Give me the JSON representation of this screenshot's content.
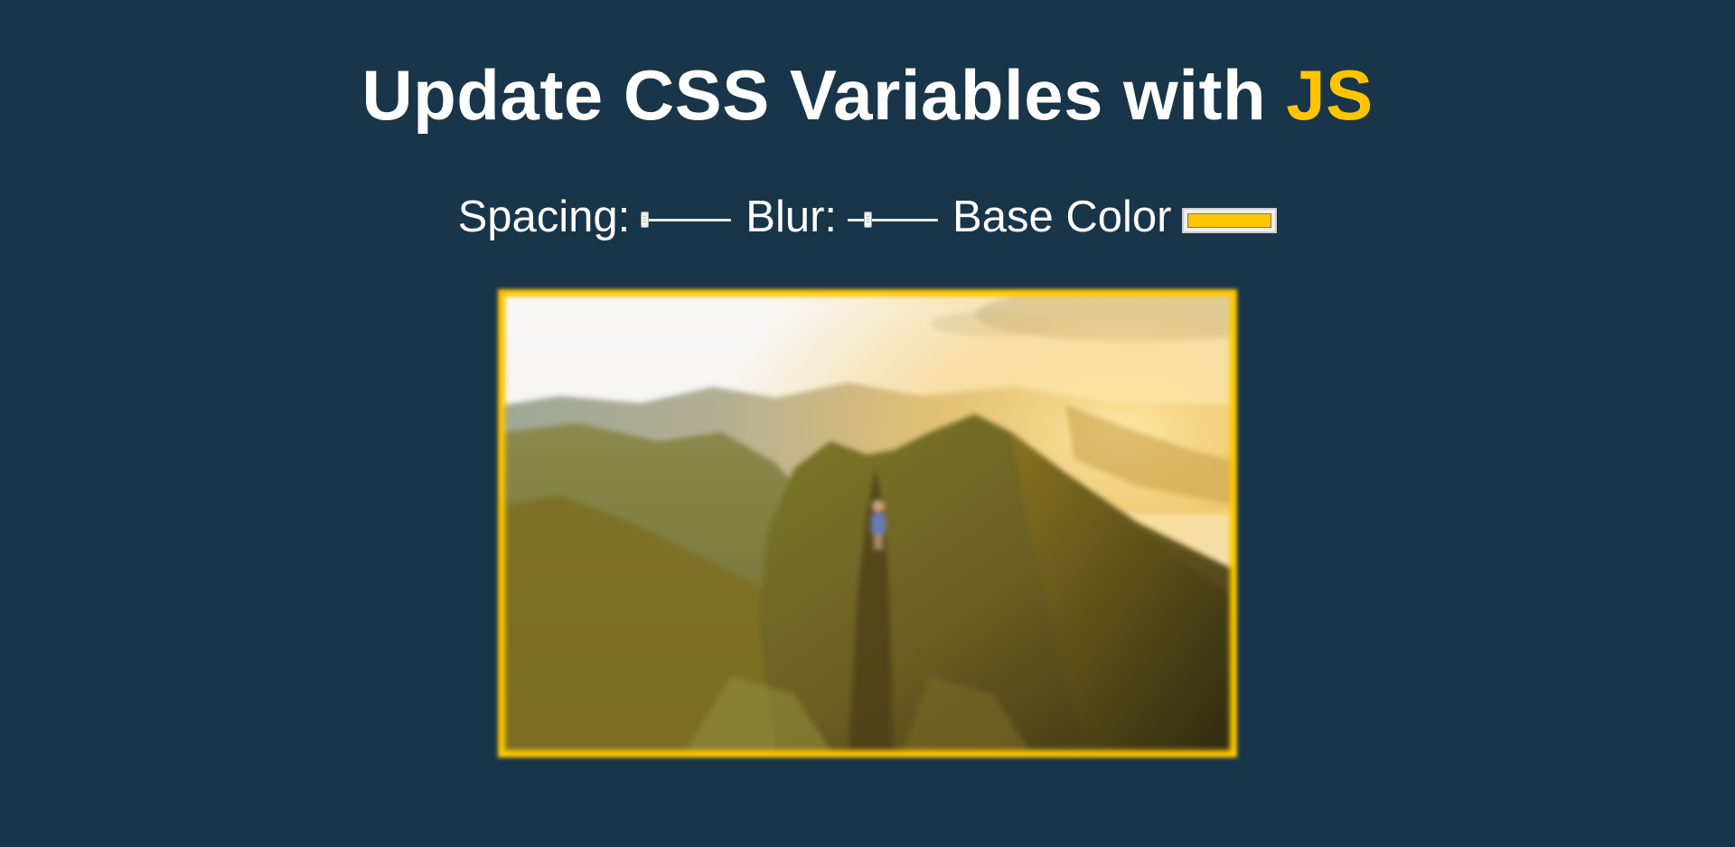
{
  "header": {
    "title_main": "Update CSS Variables with ",
    "title_highlight": "JS"
  },
  "controls": {
    "spacing_label": "Spacing:",
    "spacing_value": 0,
    "blur_label": "Blur:",
    "blur_value": 0.2,
    "base_color_label": "Base Color",
    "base_color_value": "#ffc600"
  },
  "colors": {
    "background": "#193549",
    "accent": "#ffc600"
  },
  "image": {
    "subject": "mountain-ridge-hiker-photo"
  }
}
